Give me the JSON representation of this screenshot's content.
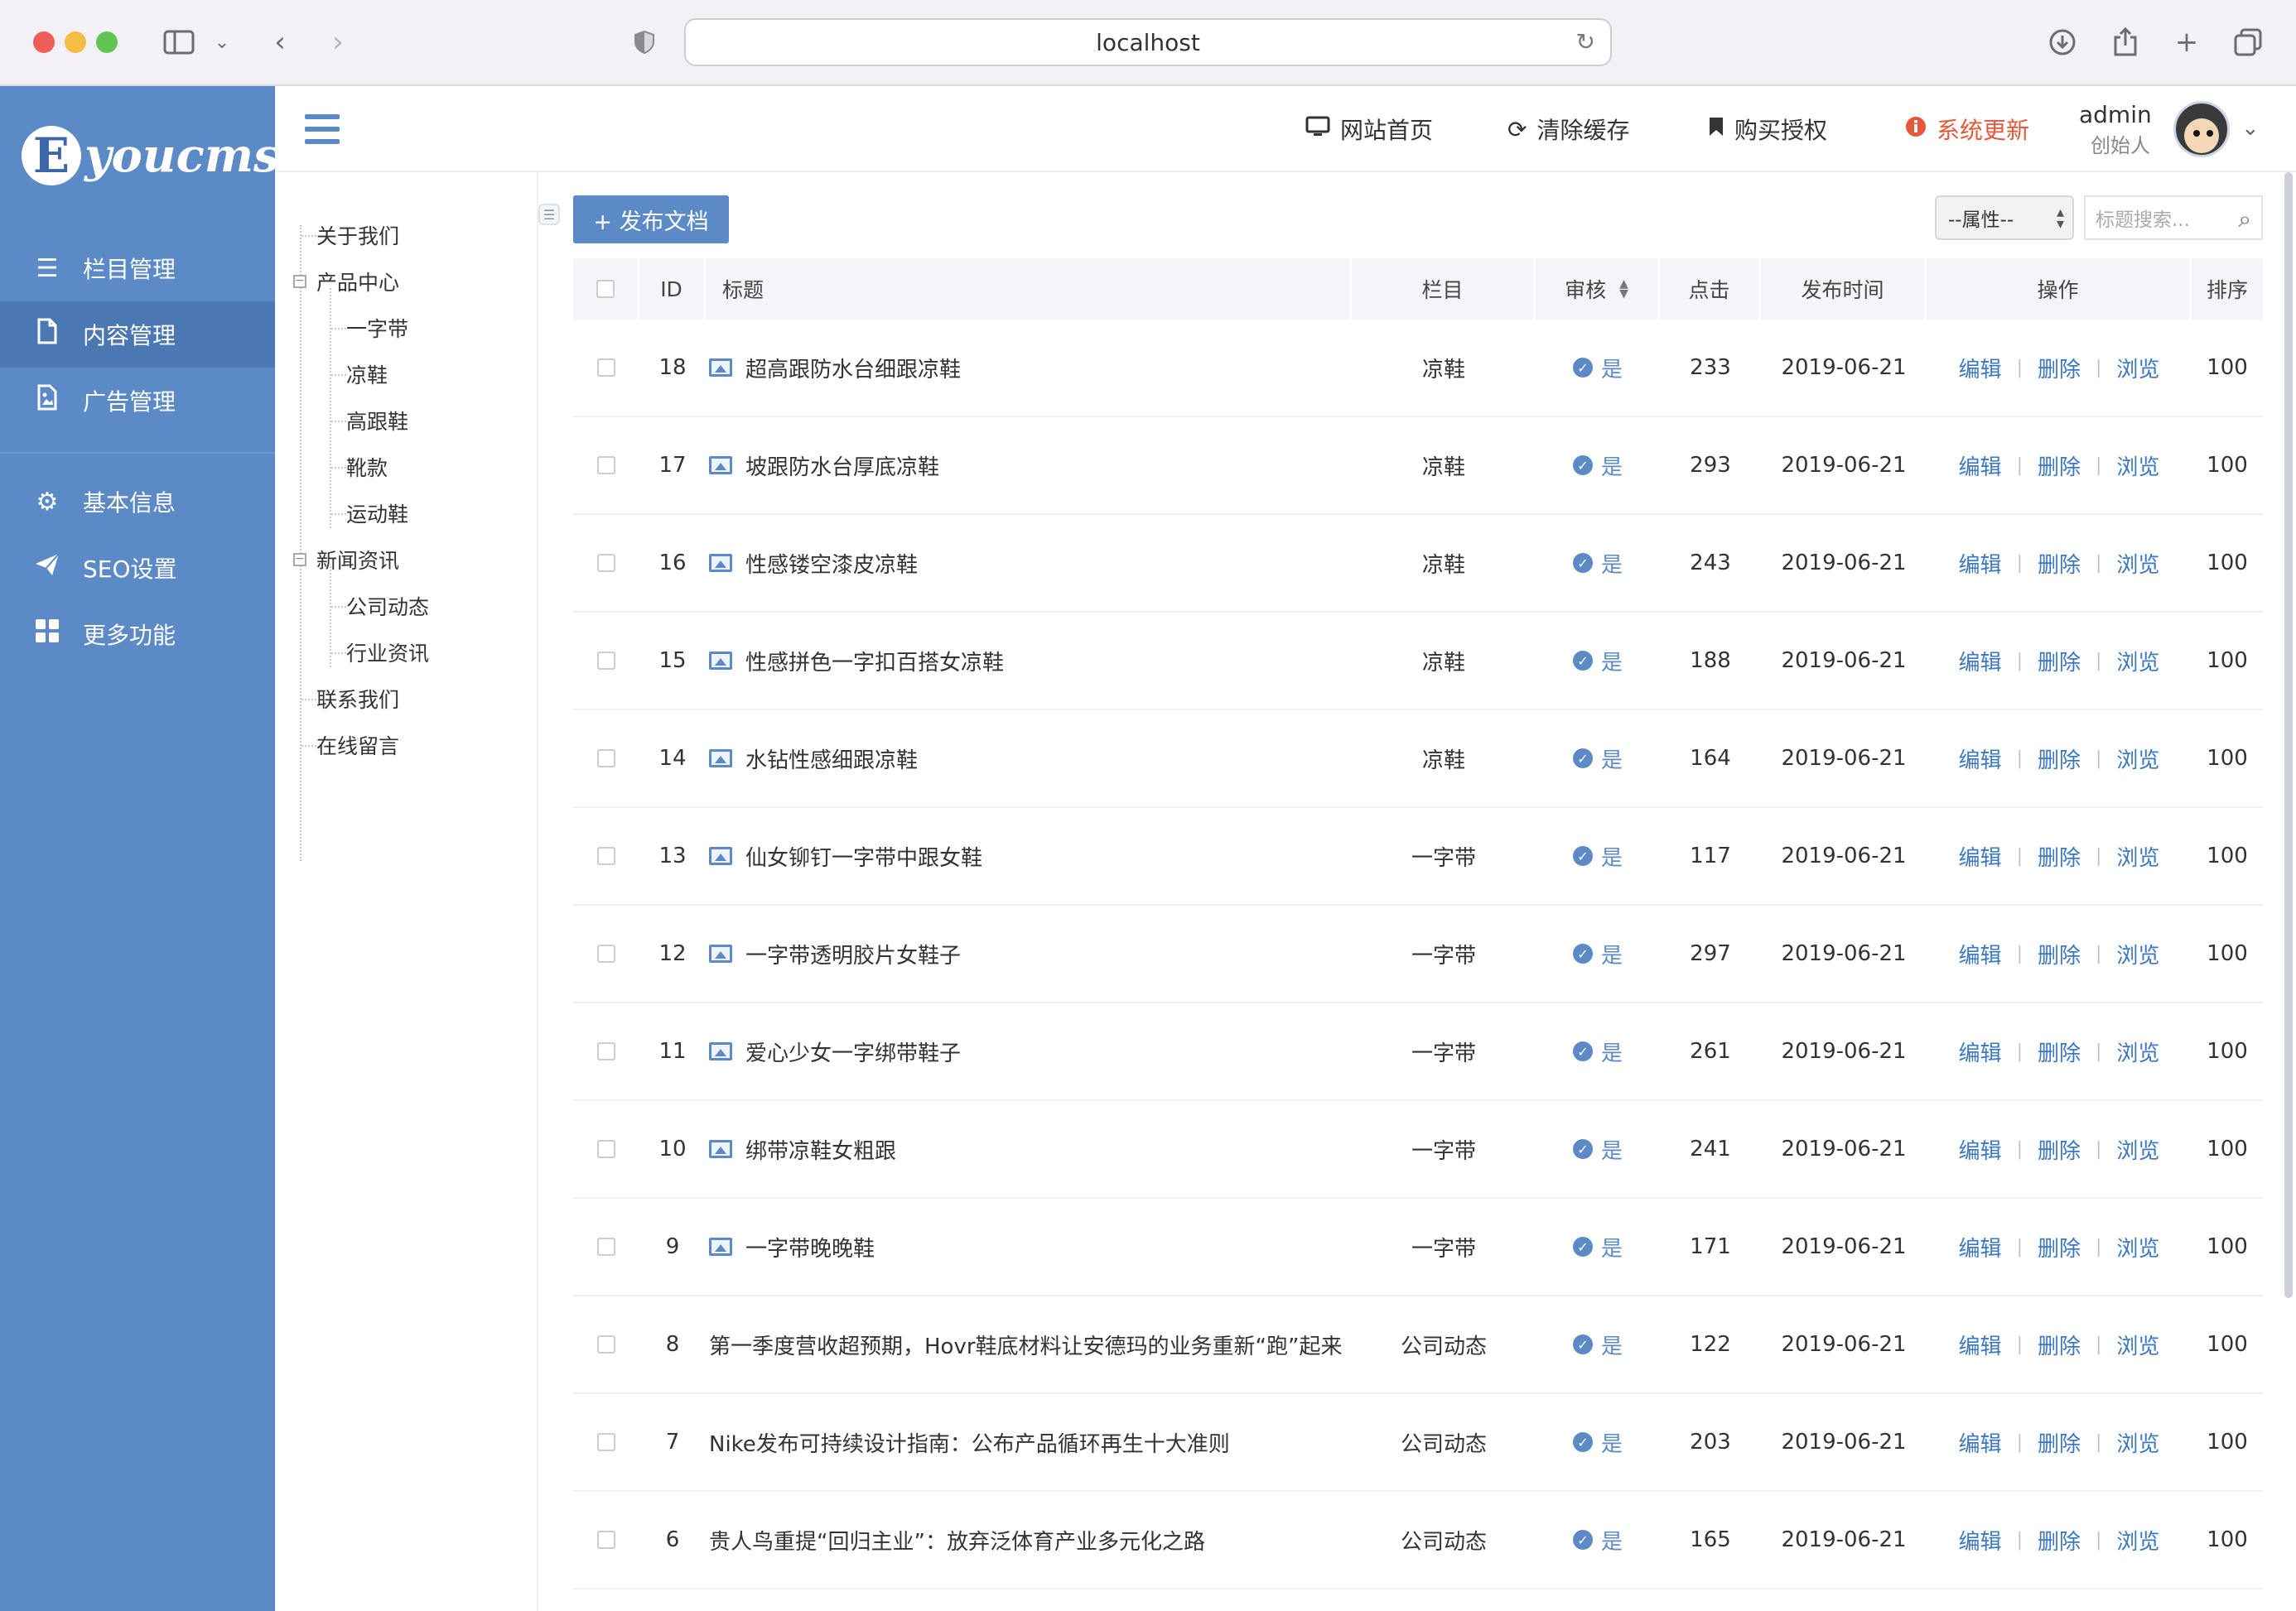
{
  "browser": {
    "url": "localhost"
  },
  "sidebar": {
    "logo_letter": "E",
    "logo_text": "youcms",
    "items": [
      {
        "label": "栏目管理",
        "icon": "list-icon"
      },
      {
        "label": "内容管理",
        "icon": "document-icon"
      },
      {
        "label": "广告管理",
        "icon": "image-file-icon"
      },
      {
        "label": "基本信息",
        "icon": "gear-icon"
      },
      {
        "label": "SEO设置",
        "icon": "paper-plane-icon"
      },
      {
        "label": "更多功能",
        "icon": "grid-icon"
      }
    ]
  },
  "header": {
    "links": [
      {
        "label": "网站首页",
        "icon": "monitor-icon"
      },
      {
        "label": "清除缓存",
        "icon": "refresh-icon"
      },
      {
        "label": "购买授权",
        "icon": "bookmark-icon"
      },
      {
        "label": "系统更新",
        "icon": "info-icon",
        "color": "#e8573a"
      }
    ],
    "user": {
      "name": "admin",
      "role": "创始人"
    }
  },
  "tree": {
    "items": [
      {
        "label": "关于我们",
        "level": 0
      },
      {
        "label": "产品中心",
        "level": 0
      },
      {
        "label": "一字带",
        "level": 1
      },
      {
        "label": "凉鞋",
        "level": 1
      },
      {
        "label": "高跟鞋",
        "level": 1
      },
      {
        "label": "靴款",
        "level": 1
      },
      {
        "label": "运动鞋",
        "level": 1
      },
      {
        "label": "新闻资讯",
        "level": 0
      },
      {
        "label": "公司动态",
        "level": 1
      },
      {
        "label": "行业资讯",
        "level": 1
      },
      {
        "label": "联系我们",
        "level": 0
      },
      {
        "label": "在线留言",
        "level": 0
      }
    ]
  },
  "toolbar": {
    "publish_label": "+ 发布文档",
    "attr_select_value": "--属性--",
    "search_placeholder": "标题搜索..."
  },
  "table": {
    "headers": {
      "id": "ID",
      "title": "标题",
      "category": "栏目",
      "review": "审核",
      "clicks": "点击",
      "date": "发布时间",
      "ops": "操作",
      "sort": "排序"
    },
    "ops": {
      "edit": "编辑",
      "delete": "删除",
      "view": "浏览"
    },
    "rows": [
      {
        "id": "18",
        "title": "超高跟防水台细跟凉鞋",
        "has_image": true,
        "category": "凉鞋",
        "review": "是",
        "clicks": "233",
        "date": "2019-06-21",
        "sort": "100"
      },
      {
        "id": "17",
        "title": "坡跟防水台厚底凉鞋",
        "has_image": true,
        "category": "凉鞋",
        "review": "是",
        "clicks": "293",
        "date": "2019-06-21",
        "sort": "100"
      },
      {
        "id": "16",
        "title": "性感镂空漆皮凉鞋",
        "has_image": true,
        "category": "凉鞋",
        "review": "是",
        "clicks": "243",
        "date": "2019-06-21",
        "sort": "100"
      },
      {
        "id": "15",
        "title": "性感拼色一字扣百搭女凉鞋",
        "has_image": true,
        "category": "凉鞋",
        "review": "是",
        "clicks": "188",
        "date": "2019-06-21",
        "sort": "100"
      },
      {
        "id": "14",
        "title": "水钻性感细跟凉鞋",
        "has_image": true,
        "category": "凉鞋",
        "review": "是",
        "clicks": "164",
        "date": "2019-06-21",
        "sort": "100"
      },
      {
        "id": "13",
        "title": "仙女铆钉一字带中跟女鞋",
        "has_image": true,
        "category": "一字带",
        "review": "是",
        "clicks": "117",
        "date": "2019-06-21",
        "sort": "100"
      },
      {
        "id": "12",
        "title": "一字带透明胶片女鞋子",
        "has_image": true,
        "category": "一字带",
        "review": "是",
        "clicks": "297",
        "date": "2019-06-21",
        "sort": "100"
      },
      {
        "id": "11",
        "title": "爱心少女一字绑带鞋子",
        "has_image": true,
        "category": "一字带",
        "review": "是",
        "clicks": "261",
        "date": "2019-06-21",
        "sort": "100"
      },
      {
        "id": "10",
        "title": "绑带凉鞋女粗跟",
        "has_image": true,
        "category": "一字带",
        "review": "是",
        "clicks": "241",
        "date": "2019-06-21",
        "sort": "100"
      },
      {
        "id": "9",
        "title": "一字带晚晚鞋",
        "has_image": true,
        "category": "一字带",
        "review": "是",
        "clicks": "171",
        "date": "2019-06-21",
        "sort": "100"
      },
      {
        "id": "8",
        "title": "第一季度营收超预期，Hovr鞋底材料让安德玛的业务重新“跑”起来",
        "has_image": false,
        "category": "公司动态",
        "review": "是",
        "clicks": "122",
        "date": "2019-06-21",
        "sort": "100"
      },
      {
        "id": "7",
        "title": "Nike发布可持续设计指南：公布产品循环再生十大准则",
        "has_image": false,
        "category": "公司动态",
        "review": "是",
        "clicks": "203",
        "date": "2019-06-21",
        "sort": "100"
      },
      {
        "id": "6",
        "title": "贵人鸟重提“回归主业”：放弃泛体育产业多元化之路",
        "has_image": false,
        "category": "公司动态",
        "review": "是",
        "clicks": "165",
        "date": "2019-06-21",
        "sort": "100"
      }
    ]
  },
  "colors": {
    "primary": "#5c8ac6",
    "sidebar_active": "#4b78b3",
    "alert": "#e8573a",
    "link": "#3c77c2"
  }
}
